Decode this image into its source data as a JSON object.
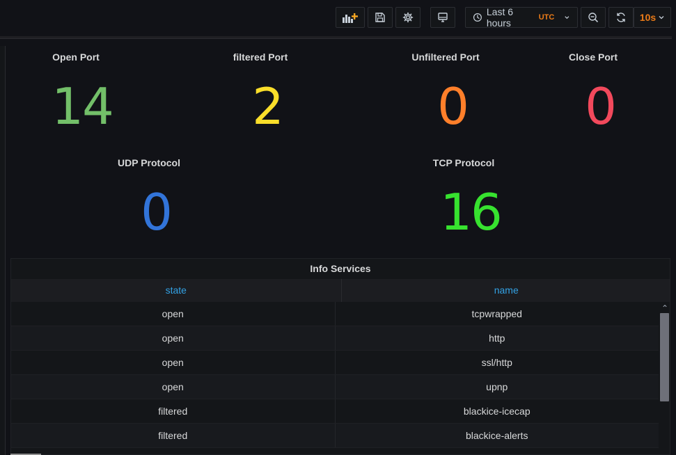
{
  "toolbar": {
    "add_panel_icon": "add-panel-icon",
    "save_icon": "save-icon",
    "settings_icon": "gear-icon",
    "tv_mode_icon": "monitor-icon",
    "time_range_label": "Last 6 hours",
    "timezone_label": "UTC",
    "zoom_out_icon": "zoom-out-icon",
    "refresh_icon": "refresh-icon",
    "refresh_interval": "10s"
  },
  "stats": [
    {
      "title": "Open Port",
      "value": "14",
      "color": "#73bf69"
    },
    {
      "title": "filtered Port",
      "value": "2",
      "color": "#fade2a"
    },
    {
      "title": "Unfiltered Port",
      "value": "0",
      "color": "#ff7f2a"
    },
    {
      "title": "Close Port",
      "value": "0",
      "color": "#f2495c"
    },
    {
      "title": "UDP Protocol",
      "value": "0",
      "color": "#3274d9"
    },
    {
      "title": "TCP Protocol",
      "value": "16",
      "color": "#37e22f"
    }
  ],
  "info_services": {
    "title": "Info Services",
    "columns": [
      "state",
      "name"
    ],
    "rows": [
      [
        "open",
        "tcpwrapped"
      ],
      [
        "open",
        "http"
      ],
      [
        "open",
        "ssl/http"
      ],
      [
        "open",
        "upnp"
      ],
      [
        "filtered",
        "blackice-icecap"
      ],
      [
        "filtered",
        "blackice-alerts"
      ]
    ]
  }
}
